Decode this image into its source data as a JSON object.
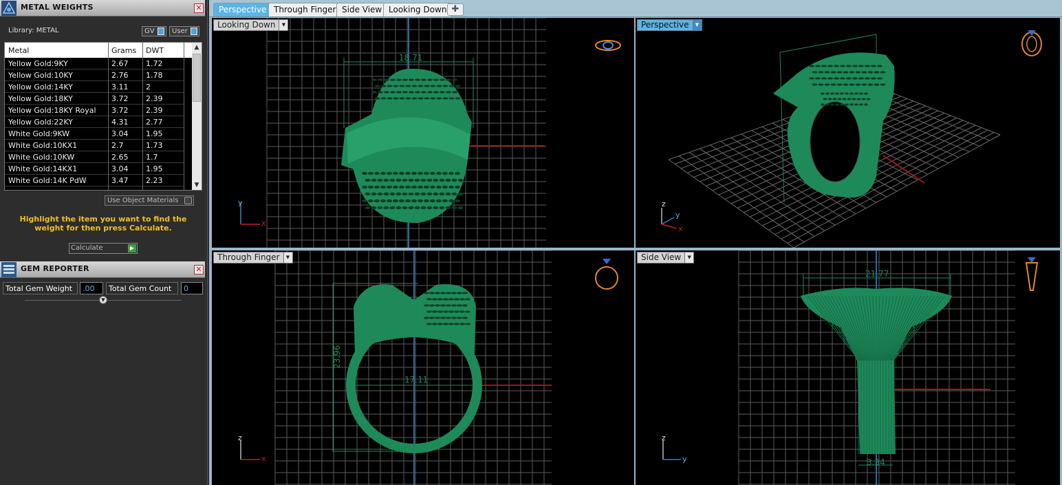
{
  "metal_weights": {
    "title": "METAL WEIGHTS",
    "library_label": "Library: METAL",
    "gv_label": "GV",
    "user_label": "User",
    "columns": [
      "Metal",
      "Grams",
      "DWT"
    ],
    "rows": [
      {
        "metal": "Yellow Gold:9KY",
        "grams": "2.67",
        "dwt": "1.72"
      },
      {
        "metal": "Yellow Gold:10KY",
        "grams": "2.76",
        "dwt": "1.78"
      },
      {
        "metal": "Yellow Gold:14KY",
        "grams": "3.11",
        "dwt": "2"
      },
      {
        "metal": "Yellow Gold:18KY",
        "grams": "3.72",
        "dwt": "2.39"
      },
      {
        "metal": "Yellow Gold:18KY Royal",
        "grams": "3.72",
        "dwt": "2.39"
      },
      {
        "metal": "Yellow Gold:22KY",
        "grams": "4.31",
        "dwt": "2.77"
      },
      {
        "metal": "White Gold:9KW",
        "grams": "3.04",
        "dwt": "1.95"
      },
      {
        "metal": "White Gold:10KX1",
        "grams": "2.7",
        "dwt": "1.73"
      },
      {
        "metal": "White Gold:10KW",
        "grams": "2.65",
        "dwt": "1.7"
      },
      {
        "metal": "White Gold:14KX1",
        "grams": "3.04",
        "dwt": "1.95"
      },
      {
        "metal": "White Gold:14K PdW",
        "grams": "3.47",
        "dwt": "2.23"
      }
    ],
    "use_object_materials": "Use Object Materials",
    "hint": "Highlight the item you want to find the weight for then press Calculate.",
    "calculate_label": "Calculate"
  },
  "gem_reporter": {
    "title": "GEM REPORTER",
    "total_weight_label": "Total Gem Weight",
    "total_weight_value": ".00",
    "total_count_label": "Total Gem Count",
    "total_count_value": "0"
  },
  "tabs": [
    "Perspective",
    "Through Finger",
    "Side View",
    "Looking Down"
  ],
  "active_tab": "Perspective",
  "viewports": {
    "looking_down": {
      "label": "Looking Down",
      "dimension": "18.71",
      "axis_v": "y",
      "axis_h": "x"
    },
    "perspective": {
      "label": "Perspective",
      "axis_z": "z",
      "axis_y": "y",
      "axis_x": "x"
    },
    "through_finger": {
      "label": "Through Finger",
      "dim_height": "23.96",
      "dim_width": "17.11",
      "axis_v": "z",
      "axis_h": "x"
    },
    "side_view": {
      "label": "Side View",
      "dim_top": "21.77",
      "dim_bottom": "3.34",
      "axis_v": "z",
      "axis_h": "y"
    }
  },
  "colors": {
    "model_green": "#1e8a5a",
    "grid": "#6a6a6a",
    "accent": "#5ab4e6",
    "hint_yellow": "#f0c020",
    "axis_blue": "#3a7fc0",
    "axis_red": "#c02020"
  }
}
